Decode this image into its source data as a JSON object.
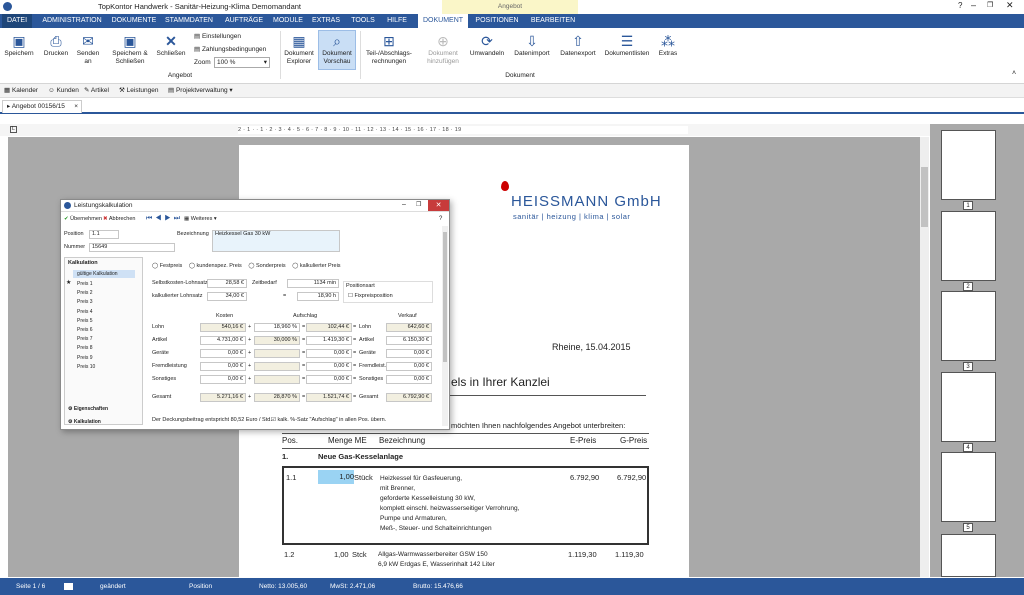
{
  "window": {
    "title": "TopKontor Handwerk - Sanitär-Heizung-Klima Demomandant",
    "context_tab": "Angebot"
  },
  "tabs": [
    "DATEI",
    "ADMINISTRATION",
    "DOKUMENTE",
    "STAMMDATEN",
    "AUFTRÄGE",
    "MODULE",
    "EXTRAS",
    "TOOLS",
    "HILFE",
    "DOKUMENT",
    "POSITIONEN",
    "BEARBEITEN"
  ],
  "ribbon": {
    "speichern": "Speichern",
    "drucken": "Drucken",
    "senden": "Senden an",
    "speichern_schliessen": "Speichern & Schließen",
    "schliessen": "Schließen",
    "einstellungen": "Einstellungen",
    "zahlungsbedingungen": "Zahlungsbedingungen",
    "zoom_label": "Zoom",
    "zoom_value": "100 %",
    "dok_explorer": "Dokument Explorer",
    "dok_vorschau": "Dokument Vorschau",
    "group_angebot": "Angebot",
    "teil_abschlag": "Teil-/Abschlags- rechnungen",
    "dok_hinzu": "Dokument hinzufügen",
    "umwandeln": "Umwandeln",
    "datenimport": "Datenimport",
    "datenexport": "Datenexport",
    "dokumentlisten": "Dokumentlisten",
    "extras": "Extras",
    "group_dokument": "Dokument"
  },
  "quick": [
    "Kalender",
    "Kunden",
    "Artikel",
    "Leistungen",
    "Projektverwaltung"
  ],
  "doc_tab": "Angebot 00156/15",
  "ruler": "2 · 1 · · 1 · 2 · 3 · 4 · 5 · 6 · 7 · 8 · 9 · 10 · 11 · 12 · 13 · 14 · 15 · 16 · 17 · 18 · 19",
  "document": {
    "company": "HEISSMANN GmbH",
    "company_sub": "sanitär | heizung | klima | solar",
    "place_date": "Rheine,  15.04.2015",
    "subject": "els in Ihrer Kanzlei",
    "intro": "möchten Ihnen nachfolgendes Angebot unterbreiten:",
    "headers": {
      "pos": "Pos.",
      "menge": "Menge ME",
      "bez": "Bezeichnung",
      "epreis": "E-Preis",
      "gpreis": "G-Preis"
    },
    "section": {
      "num": "1.",
      "title": "Neue Gas-Kesselanlage"
    },
    "rows": [
      {
        "pos": "1.1",
        "menge": "1,00",
        "me": "Stück",
        "lines": [
          "Heizkessel für Gasfeuerung,",
          "mit Brenner,",
          "geforderte Kesselleistung 30 kW,",
          "komplett einschl. heizwasserseitiger Verrohrung,",
          "Pumpe und Armaturen,",
          "Meß-, Steuer- und Schalteinrichtungen"
        ],
        "epreis": "6.792,90",
        "gpreis": "6.792,90"
      },
      {
        "pos": "1.2",
        "menge": "1,00",
        "me": "Stck",
        "lines": [
          "Allgas-Warmwasserbereiter GSW 150",
          "6,9 kW Erdgas E, Wasserinhalt 142 Liter"
        ],
        "epreis": "1.119,30",
        "gpreis": "1.119,30"
      }
    ]
  },
  "dialog": {
    "title": "Leistungskalkulation",
    "tb_uebernehmen": "Übernehmen",
    "tb_abbrechen": "Abbrechen",
    "tb_weiteres": "Weiteres",
    "position_label": "Position",
    "position_value": "1.1",
    "nummer_label": "Nummer",
    "nummer_value": "15649",
    "bez_label": "Bezeichnung",
    "bez_value": "Heizkessel Gas 30 kW",
    "side_title": "Kalkulation",
    "side_items": [
      "gültige Kalkulation",
      "Preis 1",
      "Preis 2",
      "Preis 3",
      "Preis 4",
      "Preis 5",
      "Preis 6",
      "Preis 7",
      "Preis 8",
      "Preis 9",
      "Preis 10"
    ],
    "side_bottom1": "Eigenschaften",
    "side_bottom2": "Kalkulation",
    "radios": [
      "Festpreis",
      "kundenspez. Preis",
      "Sonderpreis",
      "kalkulierter Preis"
    ],
    "slk_label": "Selbstkosten-Lohnsatz",
    "slk_value": "28,58 €",
    "zeit_label": "Zeitbedarf",
    "zeit_value": "1134 min",
    "kl_label": "kalkulierter Lohnsatz",
    "kl_value": "34,00 €",
    "kl_eq": "=",
    "kl_h": "18,90 h",
    "posart_label": "Positionsart",
    "fix_label": "Fixpreisposition",
    "col_kosten": "Kosten",
    "col_aufschlag": "Aufschlag",
    "col_verkauf": "Verkauf",
    "rows": [
      {
        "label": "Lohn",
        "kosten": "540,16 €",
        "pct": "18,960 %",
        "auf": "102,44 €",
        "lbl2": "Lohn",
        "verkauf": "642,60 €"
      },
      {
        "label": "Artikel",
        "kosten": "4.731,00 €",
        "pct": "30,000 %",
        "auf": "1.419,30 €",
        "lbl2": "Artikel",
        "verkauf": "6.150,30 €"
      },
      {
        "label": "Geräte",
        "kosten": "0,00 €",
        "pct": "",
        "auf": "0,00 €",
        "lbl2": "Geräte",
        "verkauf": "0,00 €"
      },
      {
        "label": "Fremdleistung",
        "kosten": "0,00 €",
        "pct": "",
        "auf": "0,00 €",
        "lbl2": "Fremdleist.",
        "verkauf": "0,00 €"
      },
      {
        "label": "Sonstiges",
        "kosten": "0,00 €",
        "pct": "",
        "auf": "0,00 €",
        "lbl2": "Sonstiges",
        "verkauf": "0,00 €"
      }
    ],
    "gesamt": {
      "label": "Gesamt",
      "kosten": "5.271,16 €",
      "pct": "28,870 %",
      "auf": "1.521,74 €",
      "lbl2": "Gesamt",
      "verkauf": "6.792,90 €"
    },
    "footer": "Der Deckungsbeitrag entspricht  80,52 Euro / Std.",
    "footer_chk": "kalk. %-Satz \"Aufschlag\" in allen Pos. übern."
  },
  "thumbs": [
    "1",
    "2",
    "3",
    "4",
    "5"
  ],
  "status": {
    "seite": "Seite 1 / 6",
    "geaendert": "geändert",
    "position": "Position",
    "netto": "Netto: 13.005,60",
    "mwst": "MwSt: 2.471,06",
    "brutto": "Brutto: 15.476,66"
  }
}
